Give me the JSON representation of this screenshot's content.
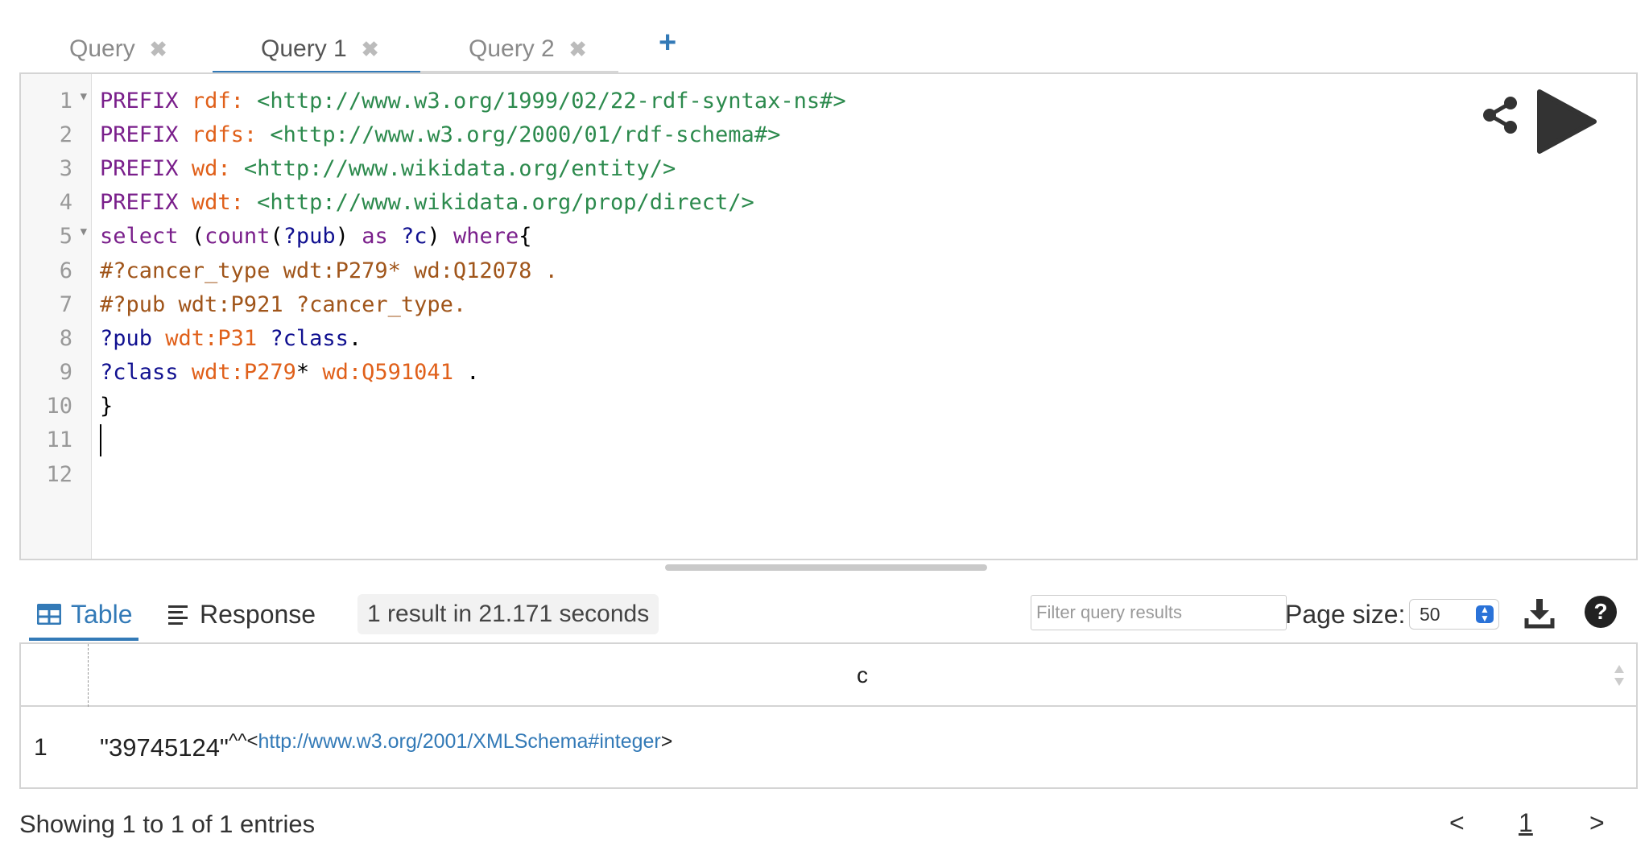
{
  "tabs": [
    {
      "label": "Query",
      "close": "✖"
    },
    {
      "label": "Query 1",
      "close": "✖"
    },
    {
      "label": "Query 2",
      "close": "✖"
    }
  ],
  "add_tab": "+",
  "editor": {
    "line_numbers": [
      "1",
      "2",
      "3",
      "4",
      "5",
      "6",
      "7",
      "8",
      "9",
      "10",
      "11",
      "12"
    ],
    "lines": {
      "l1": {
        "kw": "PREFIX",
        "pfx": "rdf:",
        "iri": "<http://www.w3.org/1999/02/22-rdf-syntax-ns#>"
      },
      "l2": {
        "kw": "PREFIX",
        "pfx": "rdfs:",
        "iri": "<http://www.w3.org/2000/01/rdf-schema#>"
      },
      "l3": {
        "kw": "PREFIX",
        "pfx": "wd:",
        "iri": "<http://www.wikidata.org/entity/>"
      },
      "l4": {
        "kw": "PREFIX",
        "pfx": "wdt:",
        "iri": "<http://www.wikidata.org/prop/direct/>"
      },
      "l5": {
        "kw1": "select",
        "p1": "(",
        "kw2": "count",
        "p2": "(",
        "v1": "?pub",
        "p3": ")",
        "kw3": "as",
        "v2": "?c",
        "p4": ")",
        "kw4": "where",
        "p5": "{"
      },
      "l6": {
        "cmt": "#?cancer_type wdt:P279* wd:Q12078 ."
      },
      "l7": {
        "cmt": "#?pub wdt:P921 ?cancer_type."
      },
      "l8": {
        "v1": "?pub",
        "pfx": "wdt:P31",
        "v2": "?class",
        "p": "."
      },
      "l9": {
        "v1": "?class",
        "pfx1": "wdt:P279",
        "star": "*",
        "pfx2": "wd:Q591041",
        "p": "."
      },
      "l10": {
        "p": "}"
      }
    }
  },
  "results": {
    "tab_table": "Table",
    "tab_response": "Response",
    "summary": "1 result in 21.171 seconds",
    "filter_placeholder": "Filter query results",
    "page_size_label": "Page size:",
    "page_size_value": "50",
    "column_header": "c",
    "rows": [
      {
        "index": "1",
        "literal": "\"39745124\"",
        "caret": "^^<",
        "datatype": "http://www.w3.org/2001/XMLSchema#integer",
        "close": ">"
      }
    ],
    "footer": "Showing 1 to 1 of 1 entries",
    "pager_prev": "<",
    "pager_page": "1",
    "pager_next": ">"
  },
  "colors": {
    "accent": "#337ab7",
    "keyword": "#7a1f8b",
    "prefix": "#e0601a",
    "iri": "#2c8a4d",
    "variable": "#101090",
    "comment": "#a0551a"
  }
}
